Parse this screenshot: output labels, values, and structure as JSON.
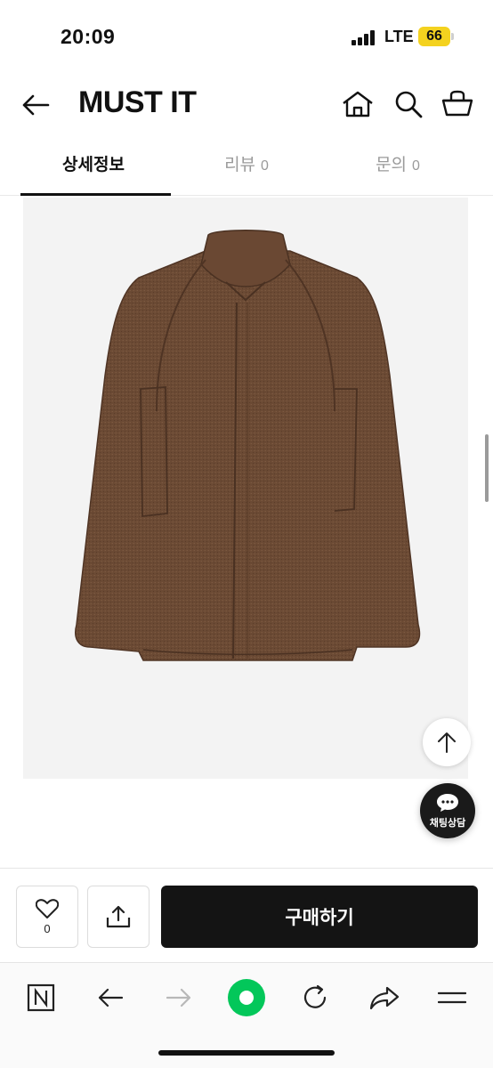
{
  "status_bar": {
    "time": "20:09",
    "network": "LTE",
    "battery": "66",
    "battery_color": "#f4d21f"
  },
  "header": {
    "brand": "MUST IT",
    "icons": [
      "back-arrow-icon",
      "home-icon",
      "search-icon",
      "cart-icon"
    ]
  },
  "tabs": [
    {
      "label": "상세정보",
      "count": "",
      "active": true
    },
    {
      "label": "리뷰",
      "count": "0",
      "active": false
    },
    {
      "label": "문의",
      "count": "0",
      "active": false
    }
  ],
  "floating": {
    "top_icon": "arrow-up-icon",
    "chat_label": "채팅상담"
  },
  "action_bar": {
    "like_count": "0",
    "buy_label": "구매하기"
  },
  "browser_bar": {
    "icons": [
      "naver-n-icon",
      "back-icon",
      "forward-icon",
      "green-dot-icon",
      "reload-icon",
      "share-icon",
      "menu-icon"
    ],
    "accent": "#03c75a"
  }
}
